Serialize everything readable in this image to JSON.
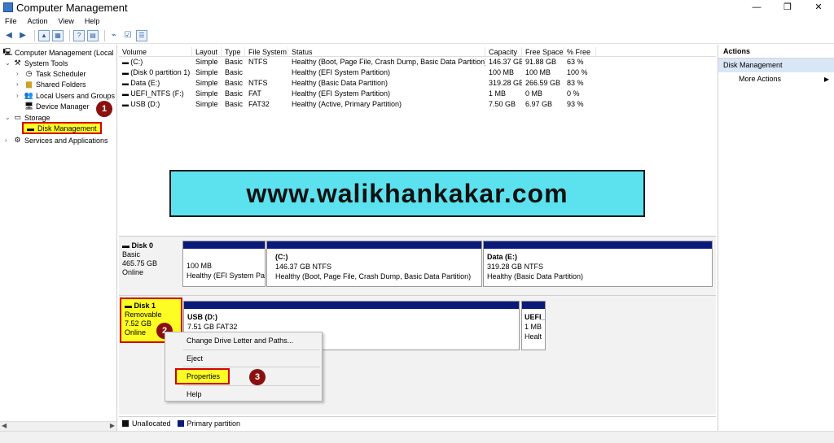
{
  "window": {
    "title": "Computer Management",
    "controls": [
      "—",
      "❐",
      "✕"
    ]
  },
  "menu": [
    "File",
    "Action",
    "View",
    "Help"
  ],
  "tree": {
    "root": "Computer Management (Local",
    "system_tools": "System Tools",
    "task_scheduler": "Task Scheduler",
    "shared_folders": "Shared Folders",
    "local_users": "Local Users and Groups",
    "device_manager": "Device Manager",
    "storage": "Storage",
    "disk_management": "Disk Management",
    "services": "Services and Applications"
  },
  "volume_table": {
    "columns": [
      "Volume",
      "Layout",
      "Type",
      "File System",
      "Status",
      "Capacity",
      "Free Space",
      "% Free"
    ],
    "rows": [
      [
        "(C:)",
        "Simple",
        "Basic",
        "NTFS",
        "Healthy (Boot, Page File, Crash Dump, Basic Data Partition)",
        "146.37 GB",
        "91.88 GB",
        "63 %"
      ],
      [
        "(Disk 0 partition 1)",
        "Simple",
        "Basic",
        "",
        "Healthy (EFI System Partition)",
        "100 MB",
        "100 MB",
        "100 %"
      ],
      [
        "Data (E:)",
        "Simple",
        "Basic",
        "NTFS",
        "Healthy (Basic Data Partition)",
        "319.28 GB",
        "266.59 GB",
        "83 %"
      ],
      [
        "UEFI_NTFS (F:)",
        "Simple",
        "Basic",
        "FAT",
        "Healthy (EFI System Partition)",
        "1 MB",
        "0 MB",
        "0 %"
      ],
      [
        "USB (D:)",
        "Simple",
        "Basic",
        "FAT32",
        "Healthy (Active, Primary Partition)",
        "7.50 GB",
        "6.97 GB",
        "93 %"
      ]
    ]
  },
  "watermark": "www.walikhankakar.com",
  "disks": {
    "disk0": {
      "name": "Disk 0",
      "type": "Basic",
      "size": "465.75 GB",
      "state": "Online",
      "partitions": [
        {
          "title": "",
          "size": "100 MB",
          "status": "Healthy (EFI System Pa"
        },
        {
          "title": "(C:)",
          "size": "146.37 GB NTFS",
          "status": "Healthy (Boot, Page File, Crash Dump, Basic Data Partition)"
        },
        {
          "title": "Data  (E:)",
          "size": "319.28 GB NTFS",
          "status": "Healthy (Basic Data Partition)"
        }
      ]
    },
    "disk1": {
      "name": "Disk 1",
      "type": "Removable",
      "size": "7.52 GB",
      "state": "Online",
      "partitions": [
        {
          "title": "USB  (D:)",
          "size": "7.51 GB FAT32",
          "status": ""
        },
        {
          "title": "UEFI_",
          "size": "1 MB",
          "status": "Healt"
        }
      ]
    }
  },
  "legend": {
    "unallocated": "Unallocated",
    "primary": "Primary partition"
  },
  "actions": {
    "header": "Actions",
    "section": "Disk Management",
    "more": "More Actions"
  },
  "context_menu": {
    "change_drive_letter": "Change Drive Letter and Paths...",
    "eject": "Eject",
    "properties": "Properties",
    "help": "Help"
  },
  "badges": [
    "1",
    "2",
    "3"
  ],
  "colors": {
    "primary_partition": "#0a1a7a",
    "highlight_border": "#d40000",
    "highlight_fill": "#ffff00",
    "badge": "#8a1010",
    "watermark_bg": "#5ce1ee"
  }
}
